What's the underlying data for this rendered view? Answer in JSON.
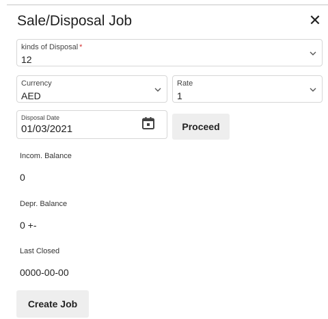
{
  "dialog": {
    "title": "Sale/Disposal Job",
    "close_symbol": "✕"
  },
  "fields": {
    "kind": {
      "label": "kinds of Disposal",
      "required_mark": "*",
      "value": "12"
    },
    "currency": {
      "label": "Currency",
      "value": "AED"
    },
    "rate": {
      "label": "Rate",
      "value": "1"
    },
    "date": {
      "label": "Disposal Date",
      "value": "01/03/2021"
    }
  },
  "buttons": {
    "proceed": "Proceed",
    "create_job": "Create Job"
  },
  "info": {
    "incom_label": "Incom. Balance",
    "incom_value": "0",
    "depr_label": "Depr. Balance",
    "depr_value": "0 +-",
    "closed_label": "Last Closed",
    "closed_value": "0000-00-00"
  },
  "icons": {
    "close": "close-icon",
    "dropdown": "chevron-down-icon",
    "calendar": "calendar-icon"
  }
}
